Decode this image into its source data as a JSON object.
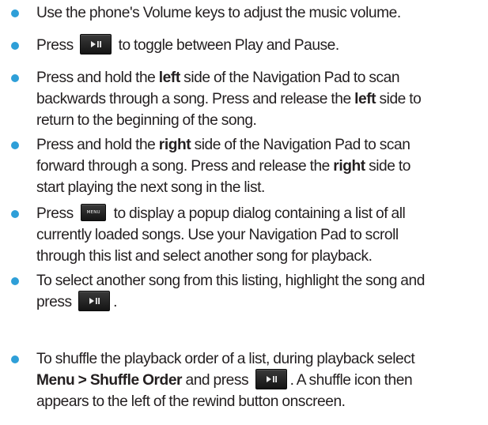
{
  "colors": {
    "bullet": "#2e9fd8",
    "text": "#231f20",
    "key_face": "#1f1f1f"
  },
  "icons": {
    "play_pause_key": "play-pause-icon",
    "menu_key": "menu-key-icon"
  },
  "items": [
    {
      "text": "Use the phone's Volume keys to adjust the music volume."
    },
    {
      "before": "Press",
      "after": "to toggle between Play and Pause."
    },
    {
      "l1_a": "Press and hold the",
      "l1_b": "left",
      "l1_c": "side of the Navigation Pad to scan",
      "l2_a": "backwards through a song. Press and release the",
      "l2_b": "left",
      "l2_c": "side to",
      "l3": "return to the beginning of the song."
    },
    {
      "l1_a": "Press and hold the",
      "l1_b": "right",
      "l1_c": "side of the Navigation Pad to scan",
      "l2_a": "forward through a song. Press and release the",
      "l2_b": "right",
      "l2_c": "side to",
      "l3": "start playing the next song in the list."
    },
    {
      "l1_a": "Press",
      "menu_key": "MENU",
      "l1_b": "to display a popup dialog containing a list of all",
      "l2": "currently loaded songs. Use your Navigation Pad to scroll",
      "l3": "through this list and select another song for playback."
    },
    {
      "l1": "To select another song from this listing, highlight the song and",
      "l2_a": "press",
      "l2_end": "."
    },
    {
      "l1": "To shuffle the playback order of a list, during playback select",
      "l2_bold": "Menu > Shuffle Order",
      "l2_b": "and press",
      "l2_end": ". A shuffle icon then",
      "l3": "appears to the left of the rewind button onscreen."
    }
  ]
}
